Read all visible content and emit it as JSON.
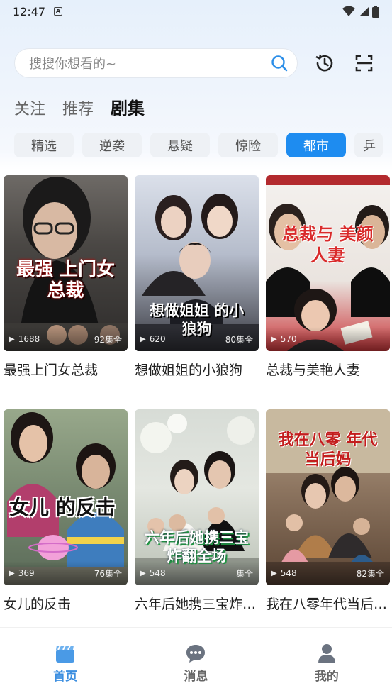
{
  "status_bar": {
    "time": "12:47"
  },
  "search": {
    "placeholder": "搜搜你想看的~"
  },
  "top_tabs": [
    {
      "label": "关注"
    },
    {
      "label": "推荐"
    },
    {
      "label": "剧集"
    }
  ],
  "genres": [
    {
      "label": "精选"
    },
    {
      "label": "逆袭"
    },
    {
      "label": "悬疑"
    },
    {
      "label": "惊险"
    },
    {
      "label": "都市"
    },
    {
      "label": "乒"
    }
  ],
  "dramas": [
    {
      "title": "最强上门女总裁",
      "views": "1688",
      "episodes": "92集全",
      "poster_text": "最强 上门女总裁"
    },
    {
      "title": "想做姐姐的小狼狗",
      "views": "620",
      "episodes": "80集全",
      "poster_text": "想做姐姐 的小狼狗"
    },
    {
      "title": "总裁与美艳人妻",
      "views": "570",
      "episodes": "",
      "poster_text": "总裁与 美颜人妻"
    },
    {
      "title": "女儿的反击",
      "views": "369",
      "episodes": "76集全",
      "poster_text": "女儿 的反击"
    },
    {
      "title": "六年后她携三宝炸…",
      "views": "548",
      "episodes": "集全",
      "poster_text": "六年后她携三宝 炸翻全场"
    },
    {
      "title": "我在八零年代当后…",
      "views": "548",
      "episodes": "82集全",
      "poster_text": "我在八零 年代当后妈"
    }
  ],
  "bottom_nav": [
    {
      "label": "首页"
    },
    {
      "label": "消息"
    },
    {
      "label": "我的"
    }
  ],
  "colors": {
    "accent": "#1e8cf0",
    "nav_active": "#3d8fe0"
  }
}
